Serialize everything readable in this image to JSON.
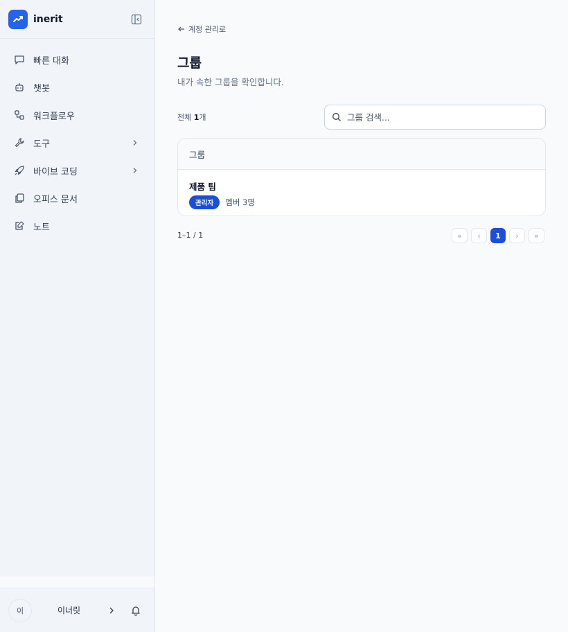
{
  "brand": {
    "name": "inerit",
    "accent": "#2563eb"
  },
  "sidebar": {
    "items": [
      {
        "label": "빠른 대화",
        "icon": "chat-bubble-icon"
      },
      {
        "label": "챗봇",
        "icon": "bot-icon"
      },
      {
        "label": "워크플로우",
        "icon": "workflow-icon"
      },
      {
        "label": "도구",
        "icon": "wrench-icon",
        "expandable": true
      },
      {
        "label": "바이브 코딩",
        "icon": "rocket-icon",
        "expandable": true
      },
      {
        "label": "오피스 문서",
        "icon": "documents-icon"
      },
      {
        "label": "노트",
        "icon": "note-icon"
      }
    ]
  },
  "user": {
    "avatar_initial": "이",
    "name": "이너릿"
  },
  "main": {
    "back_link": "계정 관리로",
    "title": "그룹",
    "subtitle": "내가 속한 그룹을 확인합니다.",
    "count_prefix": "전체 ",
    "count_value": "1",
    "count_suffix": "개",
    "search_placeholder": "그룹 검색...",
    "table": {
      "header": "그룹",
      "rows": [
        {
          "name": "제품 팀",
          "role": "관리자",
          "members": "멤버 3명"
        }
      ]
    },
    "range_text": "1–1 / 1",
    "pagination": {
      "first": "«",
      "prev": "‹",
      "current": "1",
      "next": "›",
      "last": "»"
    }
  }
}
